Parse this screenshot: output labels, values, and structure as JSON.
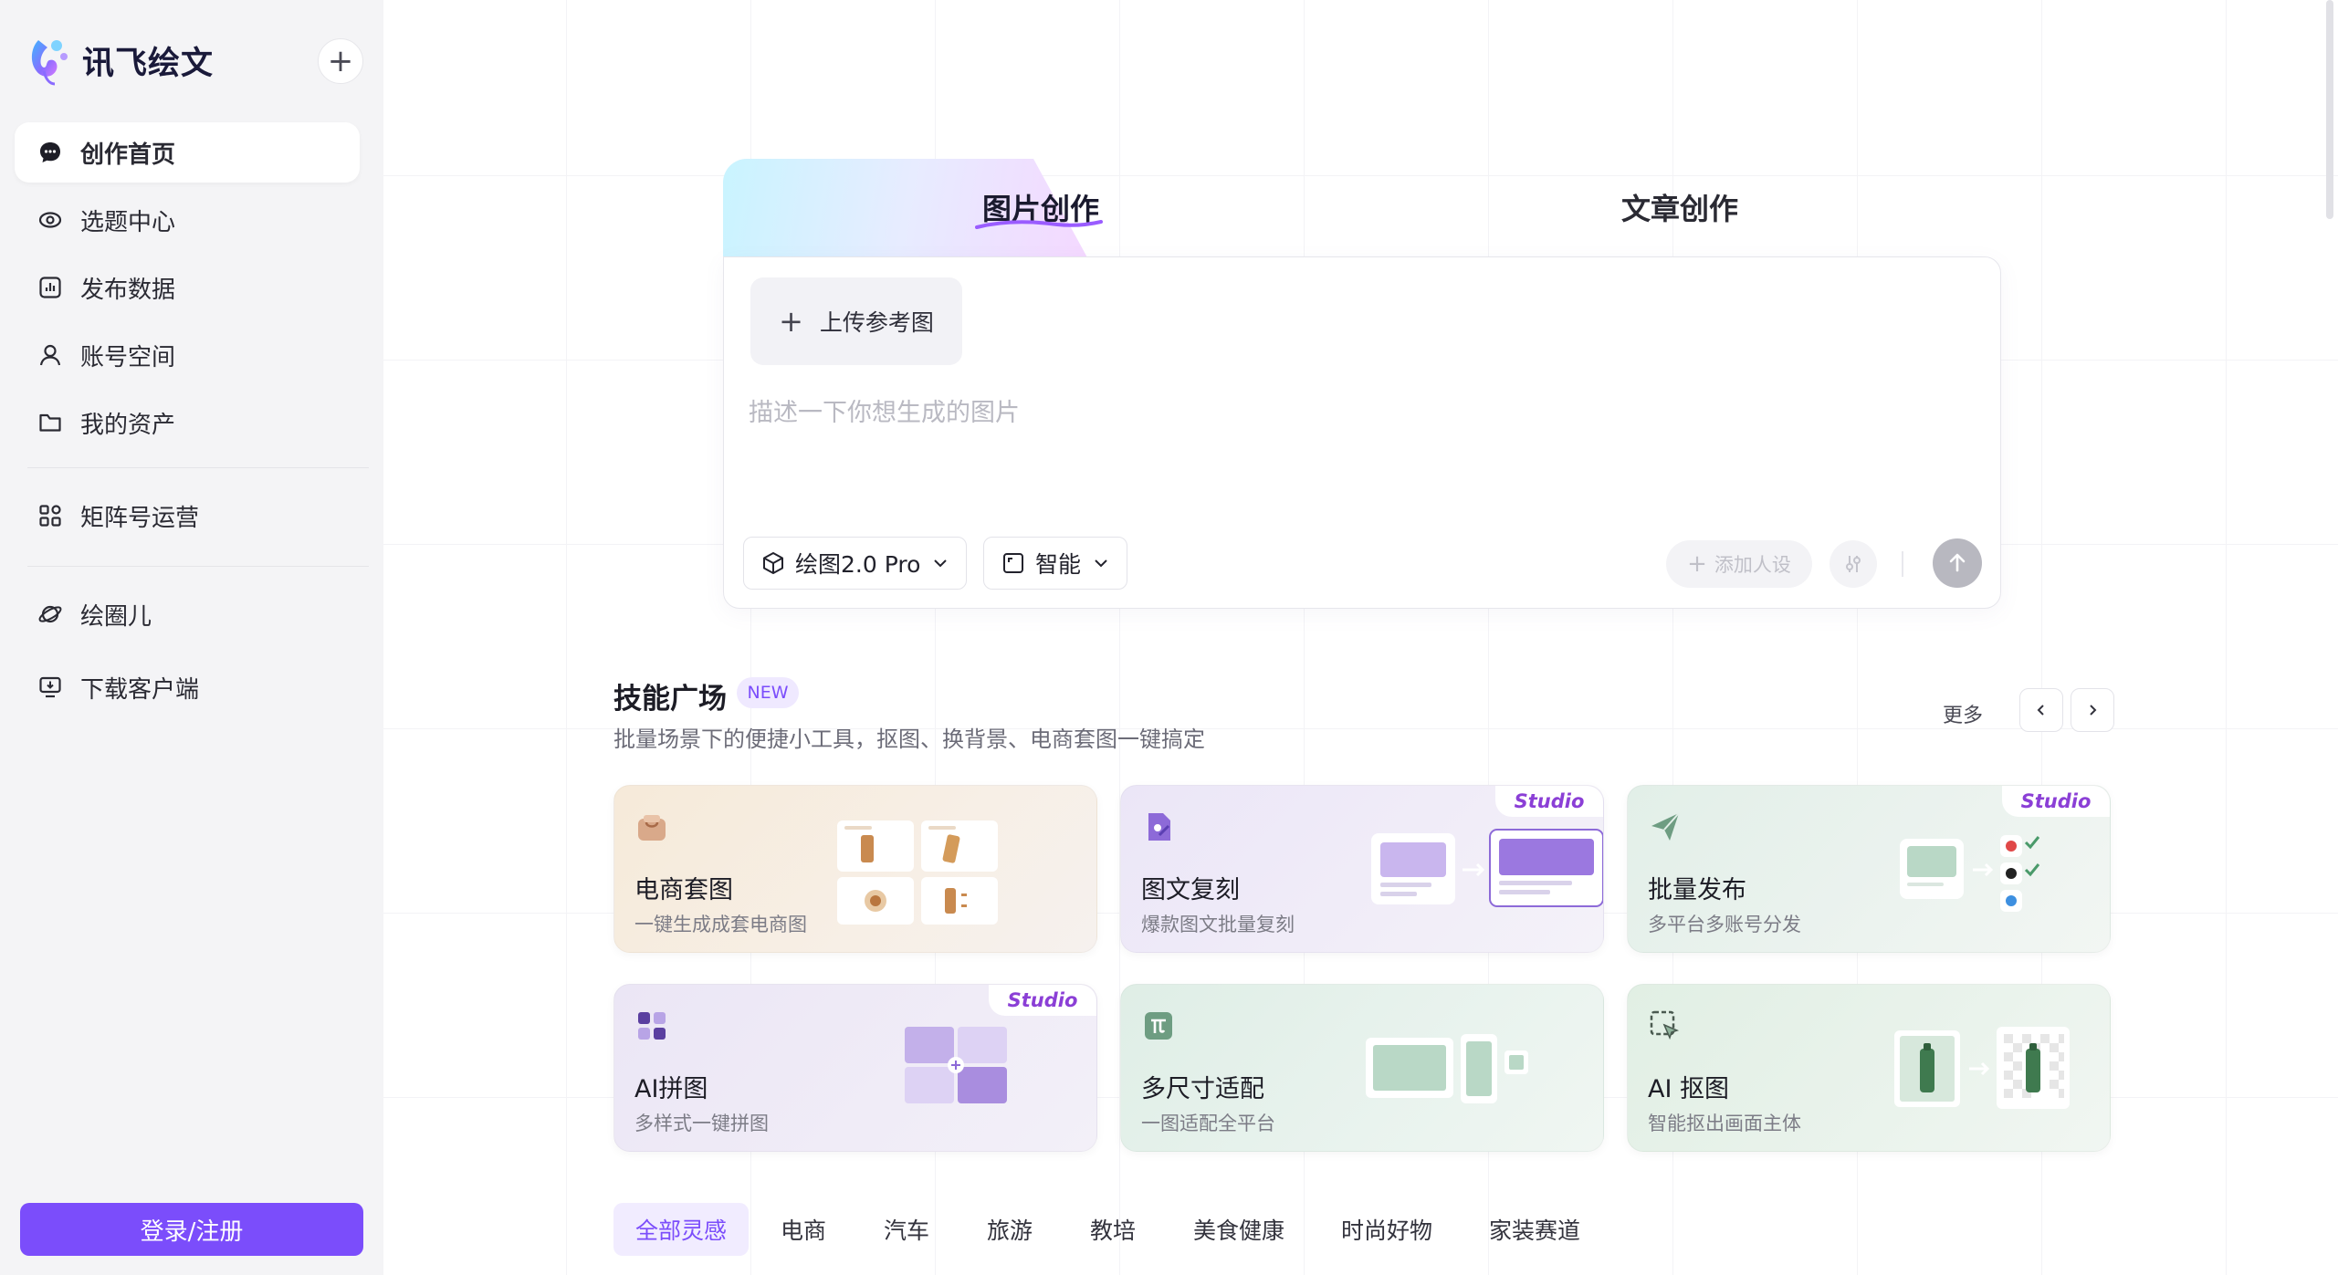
{
  "sidebar": {
    "brand": "讯飞绘文",
    "new_button_label": "+",
    "items": [
      {
        "label": "创作首页",
        "icon": "chat-bubble-icon"
      },
      {
        "label": "选题中心",
        "icon": "eye-icon"
      },
      {
        "label": "发布数据",
        "icon": "bar-chart-icon"
      },
      {
        "label": "账号空间",
        "icon": "user-icon"
      },
      {
        "label": "我的资产",
        "icon": "folder-icon"
      },
      {
        "label": "矩阵号运营",
        "icon": "grid-icon"
      },
      {
        "label": "绘圈儿",
        "icon": "planet-icon"
      },
      {
        "label": "下载客户端",
        "icon": "download-monitor-icon"
      }
    ],
    "login_label": "登录/注册"
  },
  "creator": {
    "tab_image": "图片创作",
    "tab_article": "文章创作",
    "upload_label": "上传参考图",
    "prompt_placeholder": "描述一下你想生成的图片",
    "model_label": "绘图2.0 Pro",
    "ratio_label": "智能",
    "persona_label": "添加人设"
  },
  "skills": {
    "title": "技能广场",
    "badge": "NEW",
    "subtitle": "批量场景下的便捷小工具，抠图、换背景、电商套图一键搞定",
    "more_label": "更多",
    "studio_tag": "Studio",
    "cards": [
      {
        "title": "电商套图",
        "sub": "一键生成成套电商图",
        "studio": false
      },
      {
        "title": "图文复刻",
        "sub": "爆款图文批量复刻",
        "studio": true
      },
      {
        "title": "批量发布",
        "sub": "多平台多账号分发",
        "studio": true
      },
      {
        "title": "AI拼图",
        "sub": "多样式一键拼图",
        "studio": true
      },
      {
        "title": "多尺寸适配",
        "sub": "一图适配全平台",
        "studio": false
      },
      {
        "title": "AI 抠图",
        "sub": "智能抠出画面主体",
        "studio": false
      }
    ]
  },
  "categories": [
    "全部灵感",
    "电商",
    "汽车",
    "旅游",
    "教培",
    "美食健康",
    "时尚好物",
    "家装赛道"
  ],
  "colors": {
    "accent": "#7b4dfb",
    "sidebar_bg": "#f4f4f6"
  }
}
